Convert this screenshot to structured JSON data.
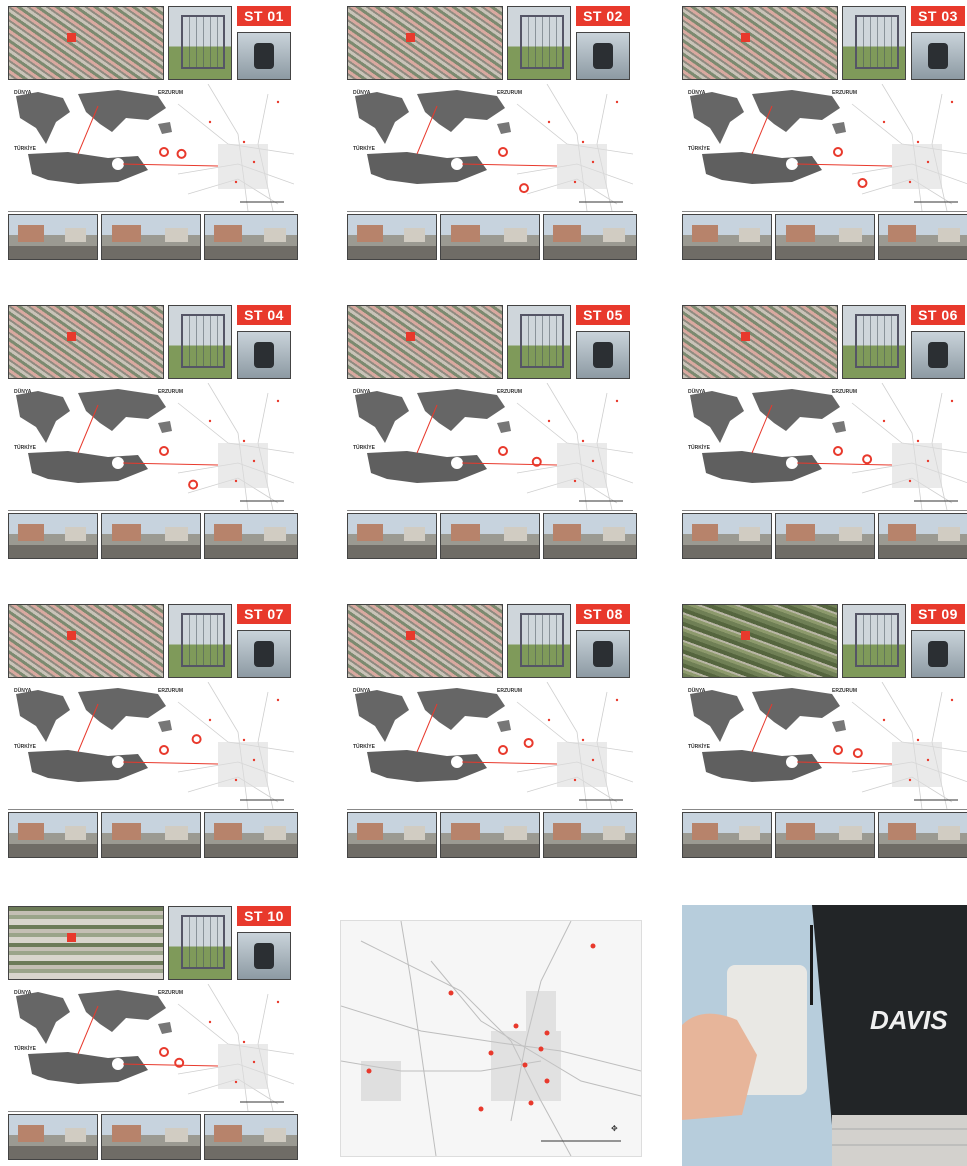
{
  "labels": {
    "world": "DÜNYA",
    "city": "ERZURUM",
    "country": "TÜRKİYE"
  },
  "stations": [
    {
      "id": "ST 01",
      "marker": [
        0.72,
        0.55
      ],
      "aerial": "urban"
    },
    {
      "id": "ST 02",
      "marker": [
        0.75,
        0.82
      ],
      "aerial": "urban"
    },
    {
      "id": "ST 03",
      "marker": [
        0.78,
        0.78
      ],
      "aerial": "urban"
    },
    {
      "id": "ST 04",
      "marker": [
        0.82,
        0.8
      ],
      "aerial": "urban"
    },
    {
      "id": "ST 05",
      "marker": [
        0.86,
        0.62
      ],
      "aerial": "urban"
    },
    {
      "id": "ST 06",
      "marker": [
        0.82,
        0.6
      ],
      "aerial": "urban"
    },
    {
      "id": "ST 07",
      "marker": [
        0.85,
        0.45
      ],
      "aerial": "urban"
    },
    {
      "id": "ST 08",
      "marker": [
        0.79,
        0.48
      ],
      "aerial": "urban"
    },
    {
      "id": "ST 09",
      "marker": [
        0.74,
        0.56
      ],
      "aerial": "green"
    },
    {
      "id": "ST 10",
      "marker": [
        0.7,
        0.62
      ],
      "aerial": "campus"
    }
  ],
  "brand": {
    "name": "DAVIS",
    "accent": "#e8392c"
  }
}
